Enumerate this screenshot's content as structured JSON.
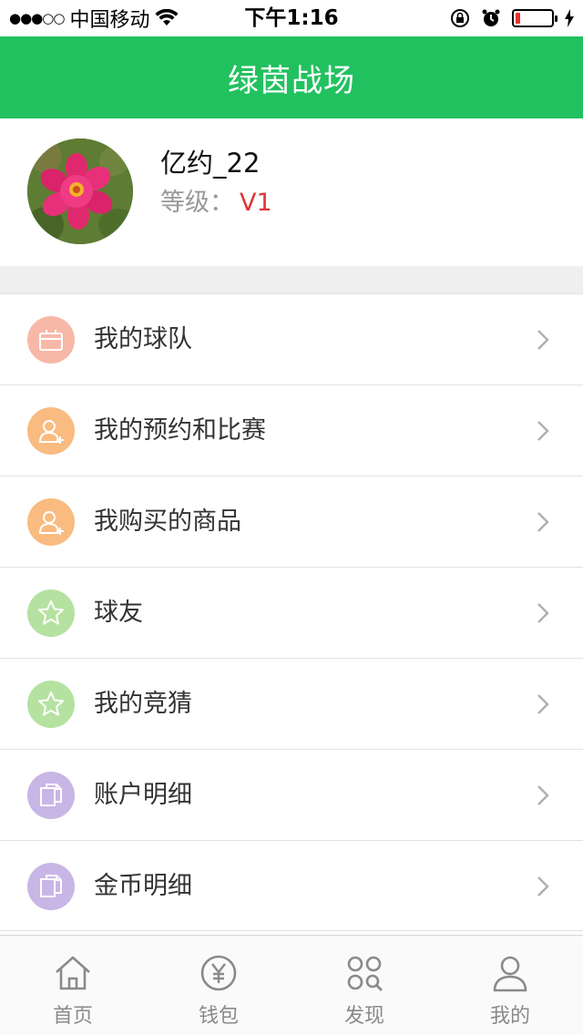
{
  "status_bar": {
    "signal": "●●●○○",
    "carrier": "中国移动",
    "time": "下午1:16",
    "battery_level": 0.12
  },
  "header": {
    "title": "绿茵战场"
  },
  "profile": {
    "username": "亿约_22",
    "level_label": "等级：",
    "level_value": "V1"
  },
  "menu": {
    "items": [
      {
        "label": "我的球队",
        "icon": "gift-icon",
        "color": "#f7b8a8"
      },
      {
        "label": "我的预约和比赛",
        "icon": "user-add-icon",
        "color": "#f9bb80"
      },
      {
        "label": "我购买的商品",
        "icon": "user-add-icon",
        "color": "#f9bb80"
      },
      {
        "label": "球友",
        "icon": "star-icon",
        "color": "#b5e2a0"
      },
      {
        "label": "我的竞猜",
        "icon": "star-icon",
        "color": "#b5e2a0"
      },
      {
        "label": "账户明细",
        "icon": "document-icon",
        "color": "#c8b6e6"
      },
      {
        "label": "金币明细",
        "icon": "document-icon",
        "color": "#c8b6e6"
      }
    ]
  },
  "tabbar": {
    "tabs": [
      {
        "label": "首页",
        "icon": "home-icon"
      },
      {
        "label": "钱包",
        "icon": "yen-icon"
      },
      {
        "label": "发现",
        "icon": "discover-icon"
      },
      {
        "label": "我的",
        "icon": "person-icon"
      }
    ]
  },
  "colors": {
    "brand": "#22c160",
    "level": "#e03434"
  }
}
